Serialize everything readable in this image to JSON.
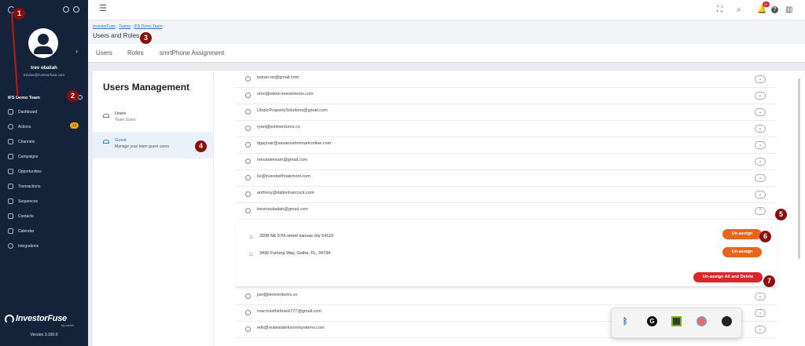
{
  "sidebar": {
    "user_name": "trev obaliah",
    "user_email": "trevine@investorfuse.com",
    "team": "IFS Demo Team",
    "items": [
      {
        "label": "Dashboard"
      },
      {
        "label": "Actions",
        "badge": "13"
      },
      {
        "label": "Channels"
      },
      {
        "label": "Campaigns"
      },
      {
        "label": "Opportunities"
      },
      {
        "label": "Transactions"
      },
      {
        "label": "Sequences"
      },
      {
        "label": "Contacts"
      },
      {
        "label": "Calendar"
      },
      {
        "label": "Integrations"
      }
    ],
    "brand": "InvestorFuse",
    "brand_sub": "by carrot",
    "version": "Version 3.100.0"
  },
  "topbar": {
    "notification_count": "9+"
  },
  "breadcrumb": {
    "items": [
      "InvestorFuse",
      "Teams",
      "IFS Demo Team"
    ],
    "title": "Users and Roles"
  },
  "tabs": [
    "Users",
    "Roles",
    "smrtPhone Assignment"
  ],
  "left": {
    "title": "Users Management",
    "users_label": "Users",
    "users_sub": "Team Users",
    "guest_label": "Guest",
    "guest_sub": "Manage your team guest users"
  },
  "rows": [
    "txdoer.rei@gmail.com",
    "omri@obnd-investments.com",
    "UtopicPropertySolutions@gmail.com",
    "ryan@jointventures.co",
    "dgaynair@savannahremarkonline.com",
    "reiostateteam@gmail.com",
    "liz@investwithoakmont.com",
    "anthony@daltonhancock.com",
    "trevineobaliah@gmail.com"
  ],
  "expanded": {
    "addresses": [
      "3208 NE 67th street kansas city 64119",
      "3436 Furlong Way, Gotha, FL, 34734"
    ],
    "unassign_label": "Un-assign",
    "unassign_all_label": "Un-assign All and Delete"
  },
  "rows_after": [
    "joe@jointventures.co",
    "rnacrossthebrack777@gmail.com",
    "erik@realestatefunnelsystems.com"
  ],
  "annotations": [
    "1",
    "2",
    "3",
    "4",
    "5",
    "6",
    "7"
  ],
  "colors": {
    "sidebar": "#14223a",
    "accent": "#e8651a",
    "danger": "#d9262b",
    "badge": "#8b0e0e"
  }
}
